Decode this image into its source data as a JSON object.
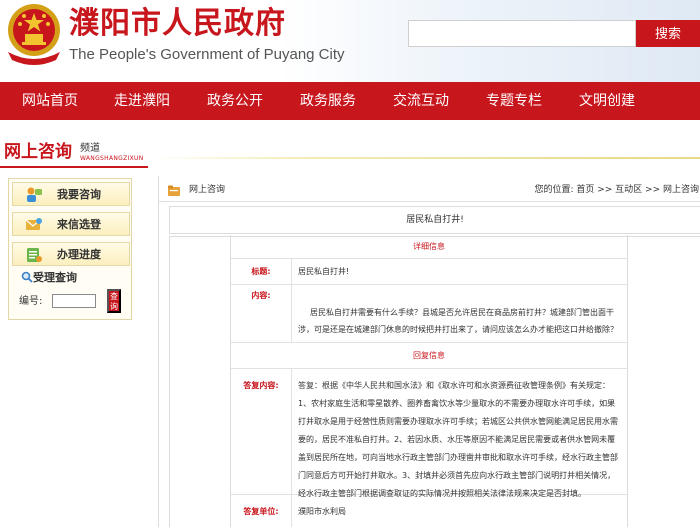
{
  "header": {
    "site_title_cn": "濮阳市人民政府",
    "site_title_en": "The People's Government of Puyang City",
    "search_placeholder": "",
    "search_button": "搜索"
  },
  "nav": {
    "items": [
      "网站首页",
      "走进濮阳",
      "政务公开",
      "政务服务",
      "交流互动",
      "专题专栏",
      "文明创建"
    ]
  },
  "channel": {
    "title": "网上咨询",
    "subtitle": "频道",
    "pinyin": "WANGSHANGZIXUN"
  },
  "sidebar": {
    "buttons": [
      "我要咨询",
      "来信选登",
      "办理进度"
    ],
    "query_title": "受理查询",
    "query_label": "编号:",
    "query_button": "查询"
  },
  "breadcrumb": {
    "name": "网上咨询",
    "path": "您的位置: 首页 >> 互动区 >> 网上咨询"
  },
  "topic": {
    "title": "居民私自打井!"
  },
  "detail": {
    "section_detail": "详细信息",
    "title_label": "标题:",
    "title_value": "居民私自打井!",
    "content_label": "内容:",
    "content_value": "居民私自打井需要有什么手续？县城是否允许居民在商品房前打井？城建部门管出面干涉，可是还是在城建部门休息的时候把井打出来了，请问应该怎么办才能把这口井给撤除？",
    "section_reply": "回复信息",
    "reply_label": "答复内容:",
    "reply_value": "答复：根据《中华人民共和国水法》和《取水许可和水资源费征收管理条例》有关规定：1、农村家庭生活和零星散养、圈养畜禽饮水等少量取水的不需要办理取水许可手续，如果打井取水是用于经营性质则需要办理取水许可手续；若城区公共供水管网能满足居民用水需要的，居民不准私自打井。2、若因水质、水压等原因不能满足居民需要或者供水管网未覆盖到居民所在地，可向当地水行政主管部门办理凿井审批和取水许可手续，经水行政主管部门同意后方可开始打井取水。3、封填井必须首先应向水行政主管部门说明打井相关情况，经水行政主管部门根据调查取证的实际情况并按照相关法律法规来决定是否封填。",
    "unit_label": "答复单位:",
    "unit_value": "濮阳市水利局"
  },
  "colors": {
    "brand_red": "#c8161d",
    "sidebar_gold": "#fbefbe"
  }
}
